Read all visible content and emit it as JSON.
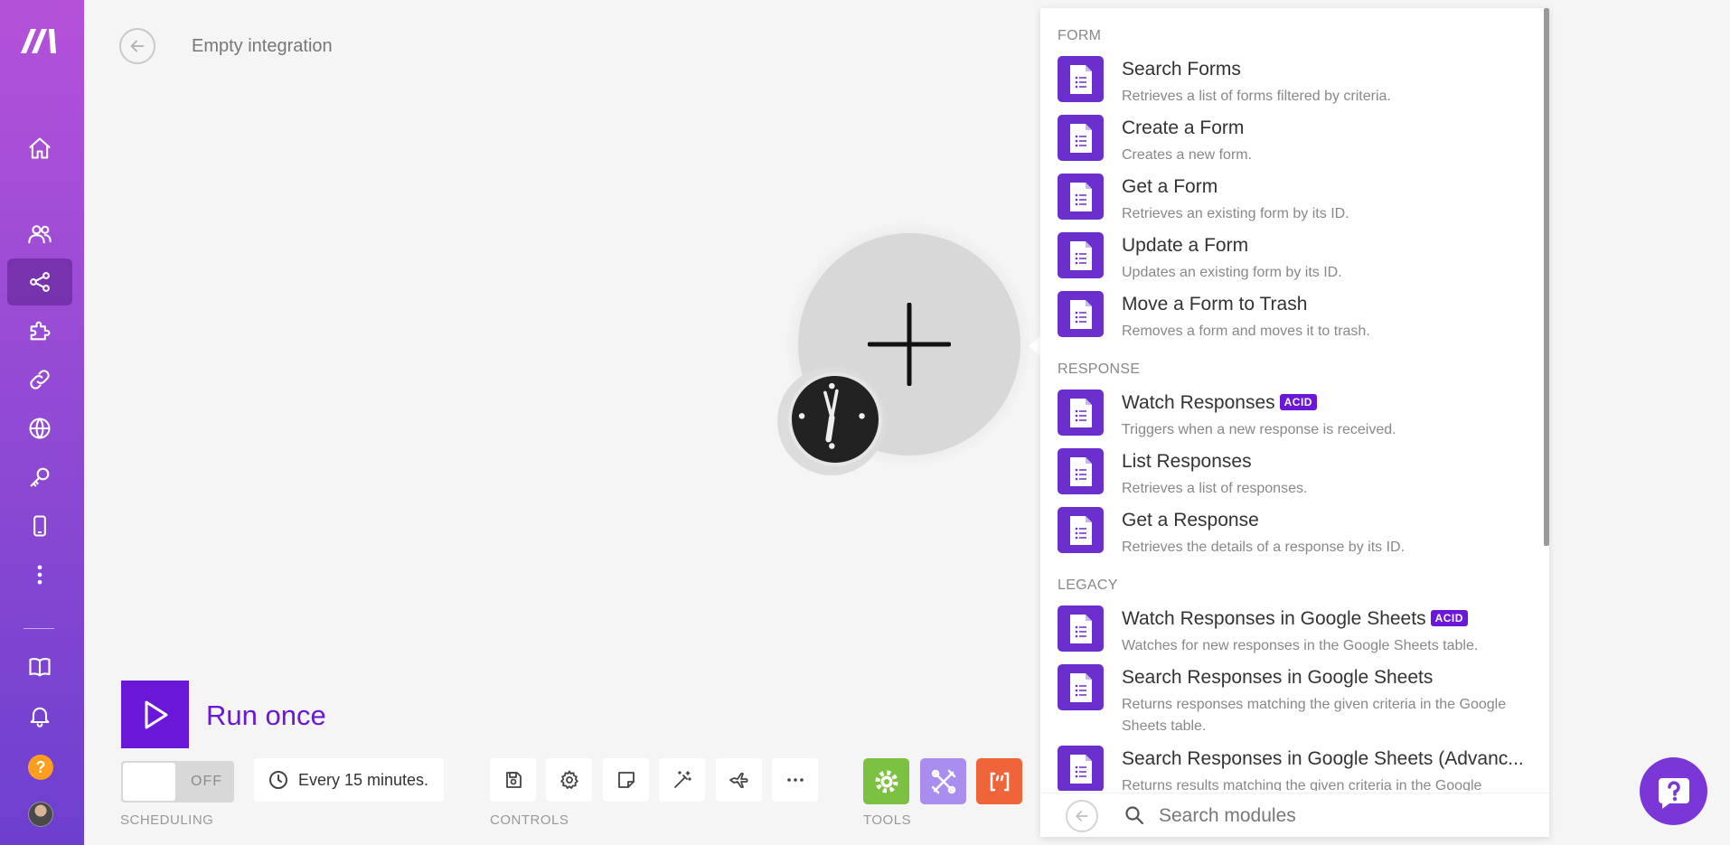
{
  "header": {
    "scenario_title": "Empty integration"
  },
  "sidebar": {
    "items": [
      {
        "icon": "home-icon"
      },
      {
        "icon": "team-icon"
      },
      {
        "icon": "share-nodes-icon",
        "active": true
      },
      {
        "icon": "puzzle-icon"
      },
      {
        "icon": "link-icon"
      },
      {
        "icon": "globe-icon"
      },
      {
        "icon": "key-icon"
      },
      {
        "icon": "mobile-icon"
      },
      {
        "icon": "more-vertical-icon"
      }
    ],
    "bottom_items": [
      {
        "icon": "book-icon"
      },
      {
        "icon": "bell-icon"
      },
      {
        "icon": "help-icon",
        "label": "?"
      },
      {
        "icon": "avatar"
      }
    ]
  },
  "bottom_bar": {
    "run_label": "Run once",
    "scheduling": {
      "toggle_state": "OFF",
      "interval_text": "Every 15 minutes.",
      "section_label": "SCHEDULING"
    },
    "controls": {
      "section_label": "CONTROLS",
      "buttons": [
        "save-icon",
        "gear-icon",
        "note-icon",
        "magic-wand-icon",
        "airplane-icon",
        "more-horizontal-icon"
      ]
    },
    "tools": {
      "section_label": "TOOLS",
      "buttons": [
        {
          "icon": "tools-gear-icon",
          "color": "#7cc142"
        },
        {
          "icon": "flow-control-icon",
          "color": "#a98ef0"
        },
        {
          "icon": "json-bracket-icon",
          "color": "#f0643a"
        }
      ]
    }
  },
  "module_panel": {
    "groups": [
      {
        "label": "FORM",
        "items": [
          {
            "name": "Search Forms",
            "desc": "Retrieves a list of forms filtered by criteria."
          },
          {
            "name": "Create a Form",
            "desc": "Creates a new form."
          },
          {
            "name": "Get a Form",
            "desc": "Retrieves an existing form by its ID."
          },
          {
            "name": "Update a Form",
            "desc": "Updates an existing form by its ID."
          },
          {
            "name": "Move a Form to Trash",
            "desc": "Removes a form and moves it to trash."
          }
        ]
      },
      {
        "label": "RESPONSE",
        "items": [
          {
            "name": "Watch Responses",
            "badge": "ACID",
            "desc": "Triggers when a new response is received."
          },
          {
            "name": "List Responses",
            "desc": "Retrieves a list of responses."
          },
          {
            "name": "Get a Response",
            "desc": "Retrieves the details of a response by its ID."
          }
        ]
      },
      {
        "label": "LEGACY",
        "items": [
          {
            "name": "Watch Responses in Google Sheets",
            "badge": "ACID",
            "desc": "Watches for new responses in the Google Sheets table."
          },
          {
            "name": "Search Responses in Google Sheets",
            "desc": "Returns responses matching the given criteria in the Google Sheets table."
          },
          {
            "name": "Search Responses in Google Sheets (Advanc...",
            "desc": "Returns results matching the given criteria in the Google"
          }
        ]
      }
    ],
    "search_placeholder": "Search modules"
  },
  "colors": {
    "brand_purple": "#6a17d8",
    "module_icon": "#6a2fcd",
    "sidebar_top": "#b451d9",
    "sidebar_bottom": "#6d3fcf"
  }
}
